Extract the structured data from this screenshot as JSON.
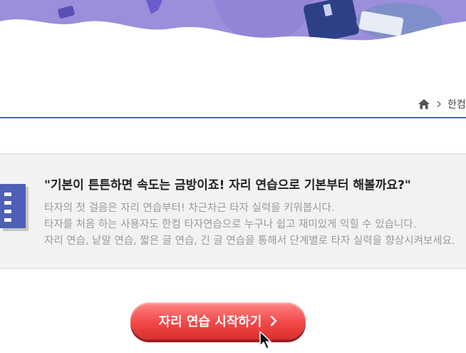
{
  "breadcrumb": {
    "home_icon": "home-icon",
    "separator_icon": "chevron-right-icon",
    "current": "한컴"
  },
  "intro": {
    "title": "\"기본이 튼튼하면 속도는 금방이죠! 자리 연습으로 기본부터 해볼까요?\"",
    "lines": [
      "타자의 첫 걸음은 자리 연습부터! 차근차근 타자 실력을 키워봅시다.",
      "타자를 처음 하는 사용자도 한컴 타자연습으로 누구나 쉽고 재미있게 익힐 수 있습니다.",
      "자리 연습, 낱말 연습, 짧은 글 연습, 긴 글 연습을 통해서 단계별로 타자 실력을 향상시켜보세요."
    ]
  },
  "start_button": {
    "label": "자리 연습 시작하기"
  },
  "colors": {
    "banner": "#9b8edb",
    "rule": "#5066a6",
    "button": "#f24848",
    "intro_bg": "#f2f2f2"
  }
}
